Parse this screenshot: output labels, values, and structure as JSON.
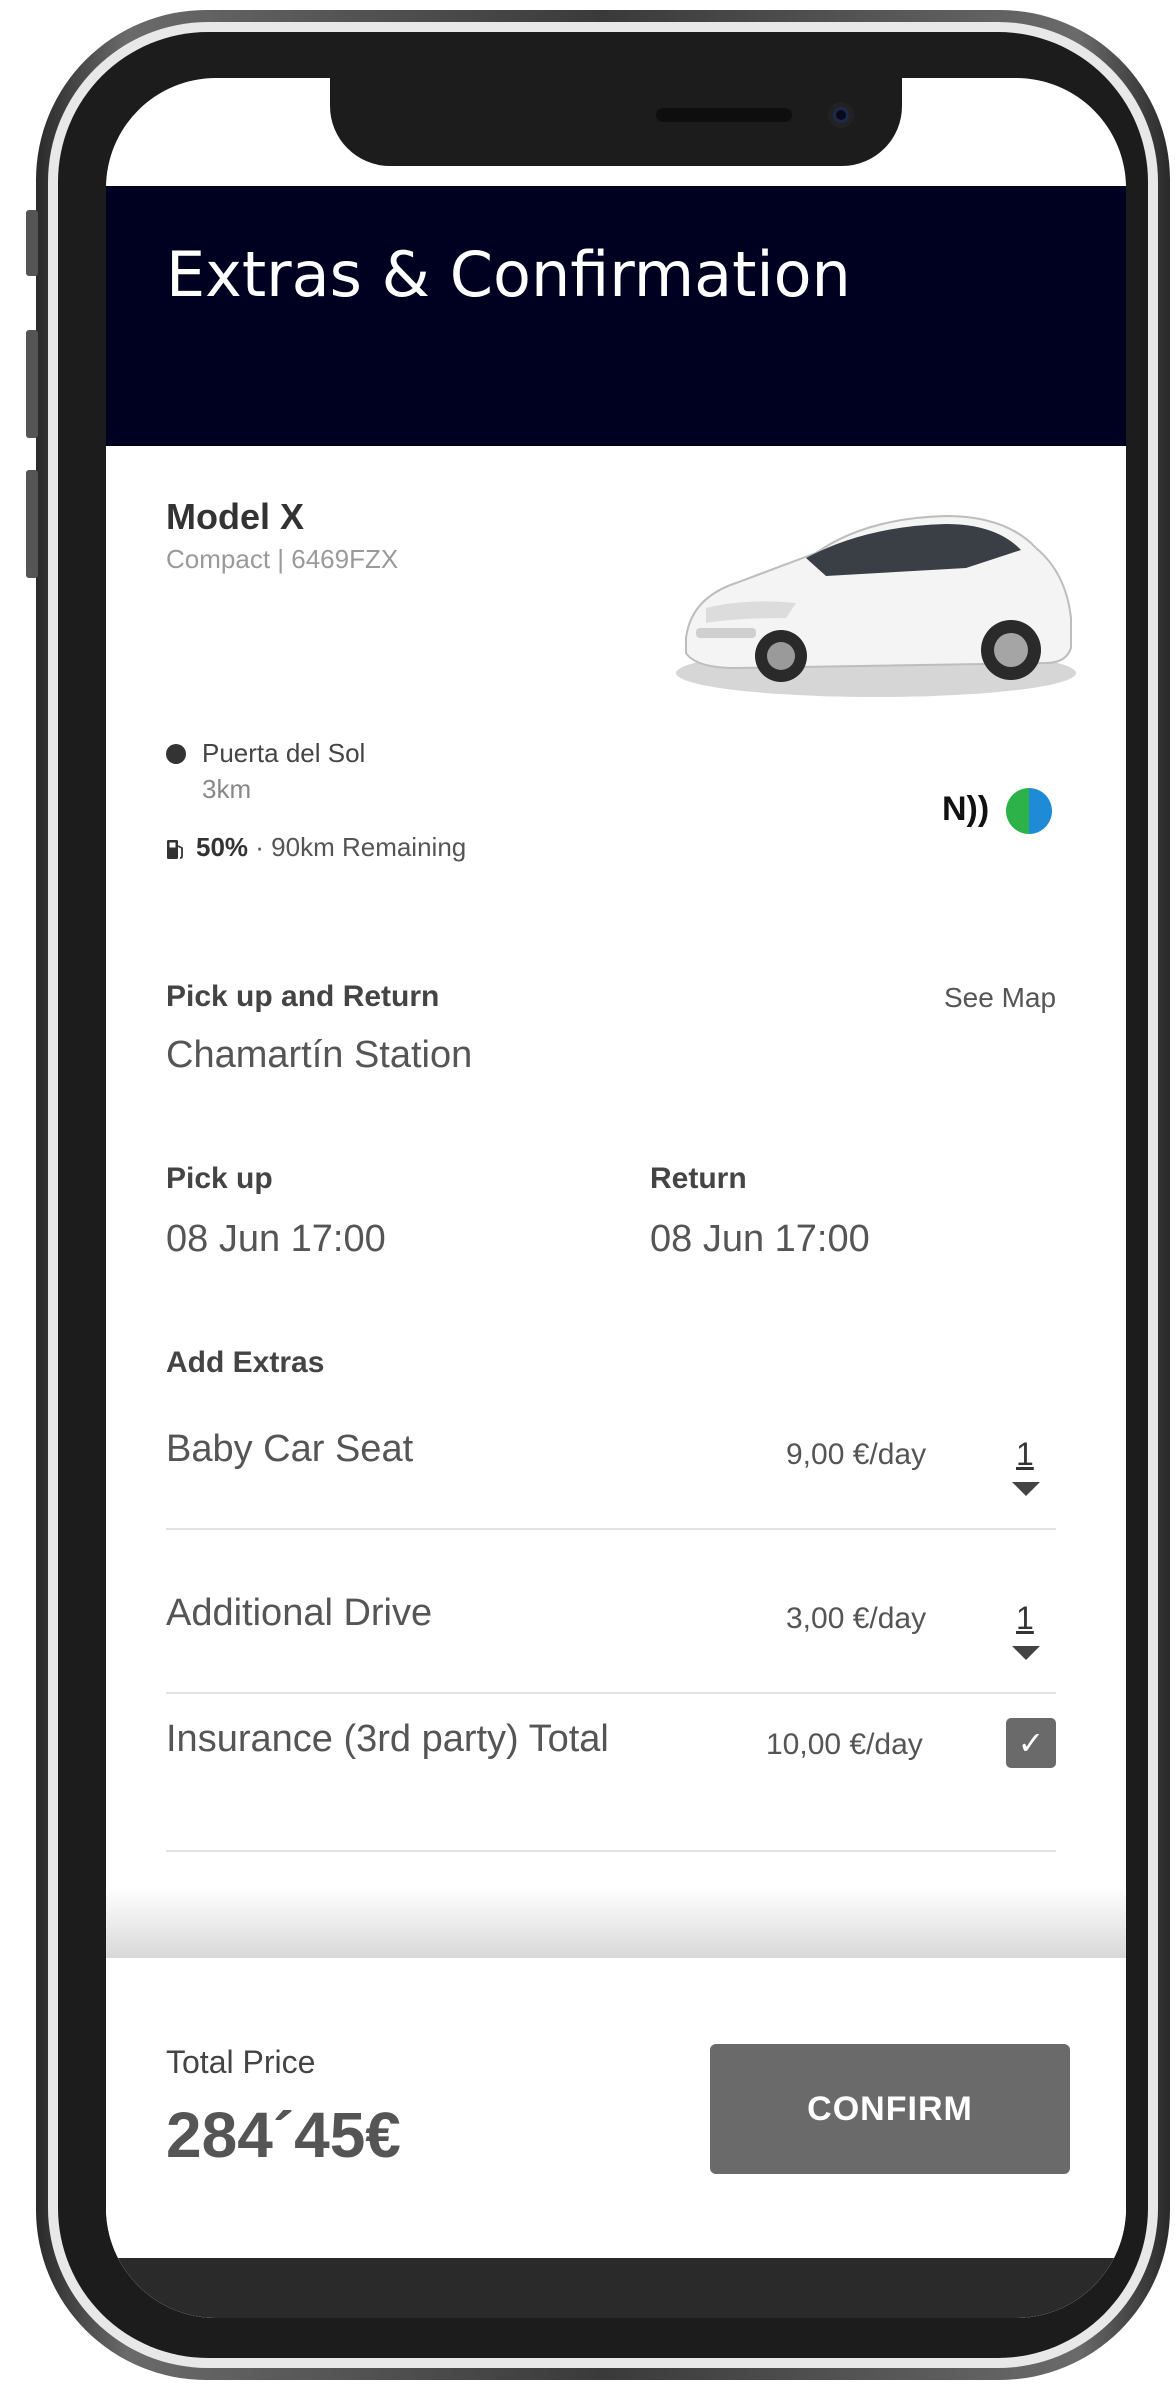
{
  "header": {
    "title": "Extras & Confirmation"
  },
  "car": {
    "name": "Model X",
    "subtitle": "Compact | 6469FZX",
    "location": "Puerta del Sol",
    "distance": "3km",
    "battery_percent": "50%",
    "battery_remaining": " · 90km Remaining",
    "nfc_symbol": "N))"
  },
  "pickup_return": {
    "label": "Pick up and Return",
    "place": "Chamartín Station",
    "see_map": "See Map"
  },
  "pickup": {
    "label": "Pick up",
    "value": "08 Jun 17:00"
  },
  "return": {
    "label": "Return",
    "value": "08 Jun 17:00"
  },
  "extras": {
    "label": "Add Extras",
    "items": [
      {
        "name": "Baby Car Seat",
        "price": "9,00 €/day",
        "qty": "1"
      },
      {
        "name": "Additional Drive",
        "price": "3,00 €/day",
        "qty": "1"
      },
      {
        "name": "Insurance (3rd party) Total",
        "price": "10,00 €/day",
        "checked": true
      }
    ]
  },
  "footer": {
    "total_label": "Total Price",
    "total_value": "284´45€",
    "confirm_label": "CONFIRM"
  },
  "icons": {
    "location": "location-pin-icon",
    "fuel": "fuel-pump-icon",
    "nfc": "nfc-icon",
    "globe": "globe-icon",
    "check": "check-icon",
    "dropdown": "chevron-down-icon"
  },
  "colors": {
    "header_bg": "#000020",
    "button_bg": "#6a6a6a",
    "text": "#555555"
  }
}
